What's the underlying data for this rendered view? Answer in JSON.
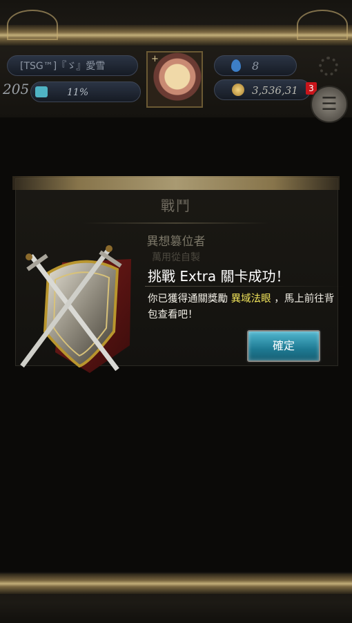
{
  "header": {
    "player_name": "[TSG™]『ゞ』愛雪",
    "level": "205",
    "exp_percent": "11%",
    "gems": "8",
    "gold": "3,536,31",
    "notification_count": "3"
  },
  "panel": {
    "title": "戰鬥",
    "subtitle": "異想篡位者",
    "subtitle_partial": "萬用從自製"
  },
  "message": {
    "title": "挑戰 Extra 關卡成功！",
    "body_prefix": "你已獲得通關獎勵 ",
    "reward_item": "異域法眼",
    "body_suffix": " ，馬上前往背包查看吧！",
    "confirm_label": "確定"
  },
  "colors": {
    "highlight": "#f0e35a",
    "button": "#2a8fa9",
    "badge": "#c8151b"
  }
}
